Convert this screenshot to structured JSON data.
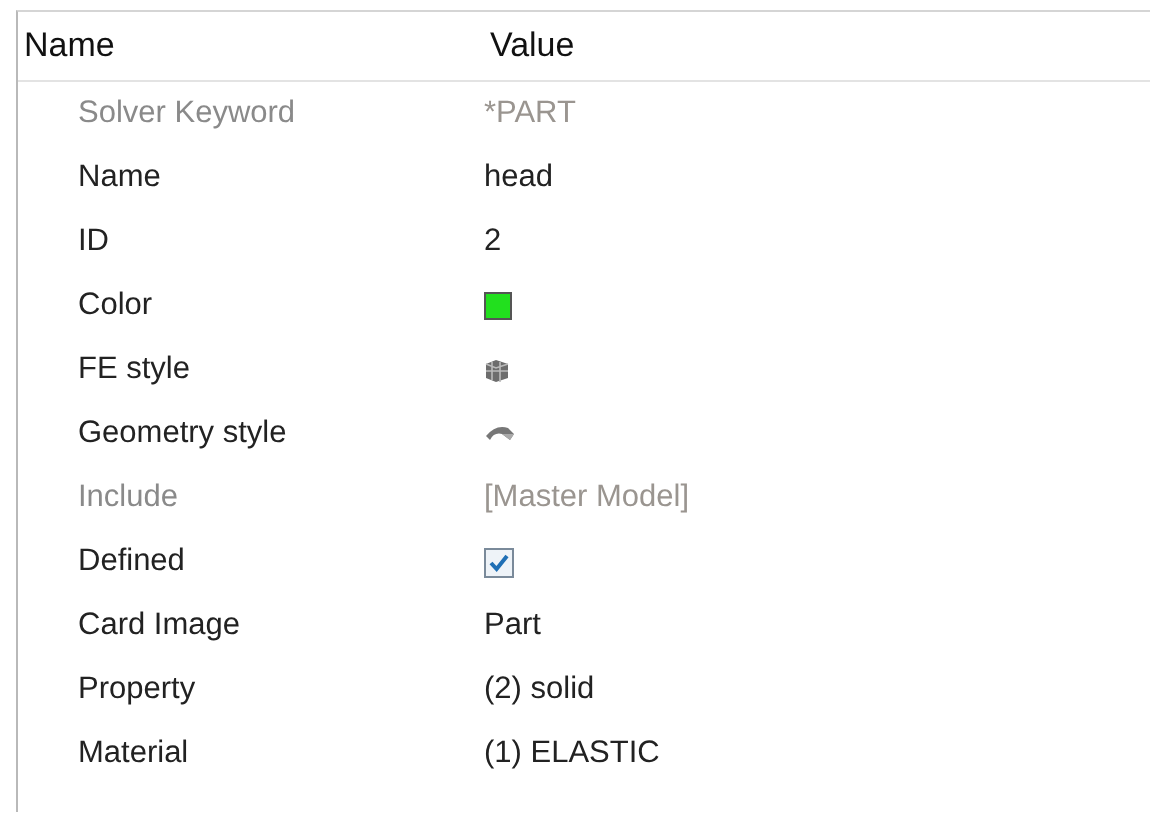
{
  "columns": [
    "Name",
    "Value"
  ],
  "rows": [
    {
      "name": "Solver Keyword",
      "kind": "text",
      "value": "*PART",
      "disabled": true
    },
    {
      "name": "Name",
      "kind": "text",
      "value": "head",
      "disabled": false
    },
    {
      "name": "ID",
      "kind": "text",
      "value": "2",
      "disabled": false
    },
    {
      "name": "Color",
      "kind": "color",
      "color": "#22e01e",
      "disabled": false
    },
    {
      "name": "FE style",
      "kind": "fe-style",
      "disabled": false
    },
    {
      "name": "Geometry style",
      "kind": "geometry-style",
      "disabled": false
    },
    {
      "name": "Include",
      "kind": "text",
      "value": "[Master Model]",
      "disabled": true
    },
    {
      "name": "Defined",
      "kind": "checkbox",
      "checked": true,
      "disabled": false
    },
    {
      "name": "Card Image",
      "kind": "text",
      "value": "Part",
      "disabled": false
    },
    {
      "name": "Property",
      "kind": "text",
      "value": "(2) solid",
      "disabled": false
    },
    {
      "name": "Material",
      "kind": "text",
      "value": "(1) ELASTIC",
      "disabled": false
    }
  ]
}
